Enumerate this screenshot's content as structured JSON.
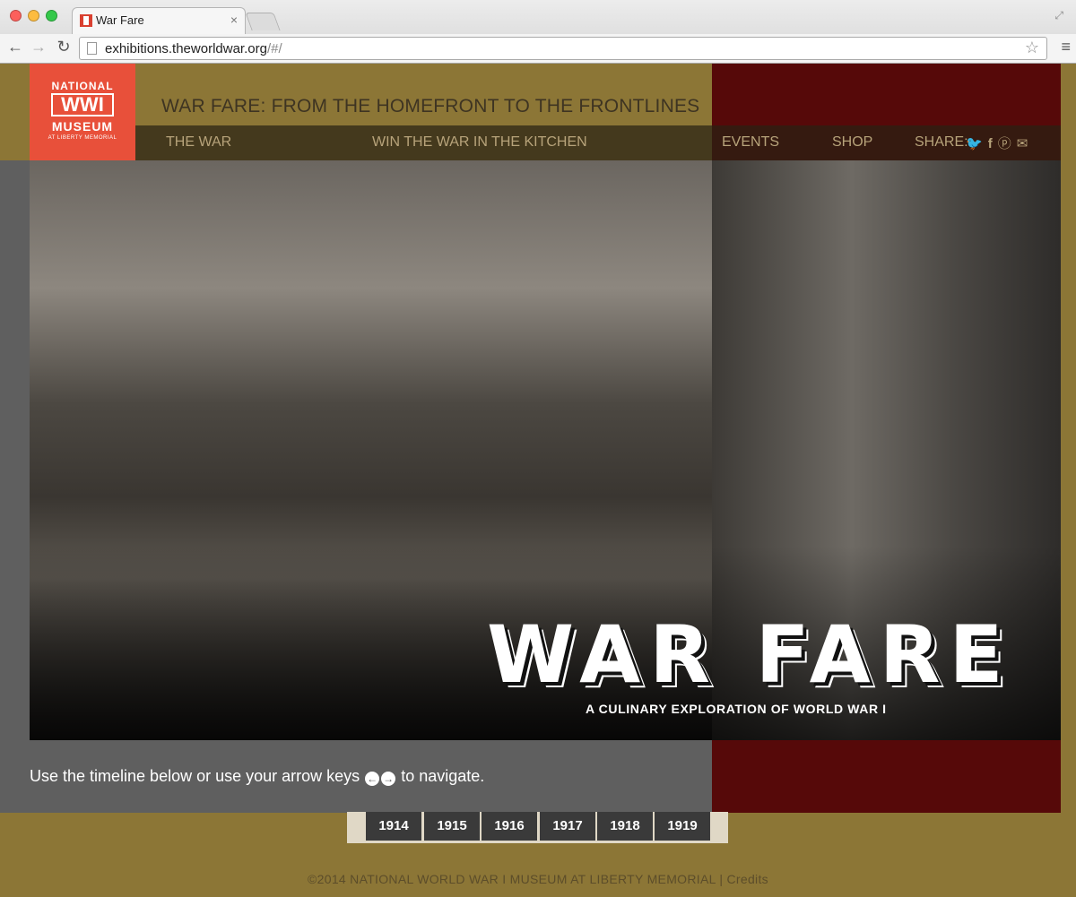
{
  "browser": {
    "tab_title": "War Fare",
    "tab_close": "×",
    "url_host": "exhibitions.theworldwar.org",
    "url_path": "/#/",
    "back_glyph": "←",
    "forward_glyph": "→",
    "reload_glyph": "↻",
    "star_glyph": "☆",
    "menu_glyph": "≡",
    "resize_glyph": "⤢"
  },
  "logo": {
    "line1": "NATIONAL",
    "line2": "WWI",
    "line3": "MUSEUM",
    "line4": "AT LIBERTY MEMORIAL"
  },
  "header": {
    "title": "WAR FARE: FROM THE HOMEFRONT TO THE FRONTLINES"
  },
  "nav": {
    "the_war": "THE WAR",
    "win_the_war": "WIN THE WAR IN THE KITCHEN",
    "events": "EVENTS",
    "shop": "SHOP",
    "share": "SHARE:",
    "icons": {
      "twitter": "twitter-icon",
      "facebook": "facebook-icon",
      "pinterest": "pinterest-icon",
      "email": "email-icon"
    }
  },
  "hero": {
    "title": "WAR FARE",
    "subtitle": "A CULINARY EXPLORATION OF WORLD WAR I"
  },
  "instructions": {
    "before": "Use the timeline below or use your arrow keys",
    "left_arrow": "←",
    "right_arrow": "→",
    "after": "to navigate."
  },
  "timeline": {
    "years": [
      "1914",
      "1915",
      "1916",
      "1917",
      "1918",
      "1919"
    ]
  },
  "footer": {
    "copyright": "©2014 NATIONAL WORLD WAR I MUSEUM AT LIBERTY MEMORIAL",
    "separator": "|",
    "credits": "Credits"
  },
  "colors": {
    "gold": "#8c7636",
    "maroon": "#560909",
    "gray": "#5f5f5f",
    "logo_red": "#e8503a"
  }
}
